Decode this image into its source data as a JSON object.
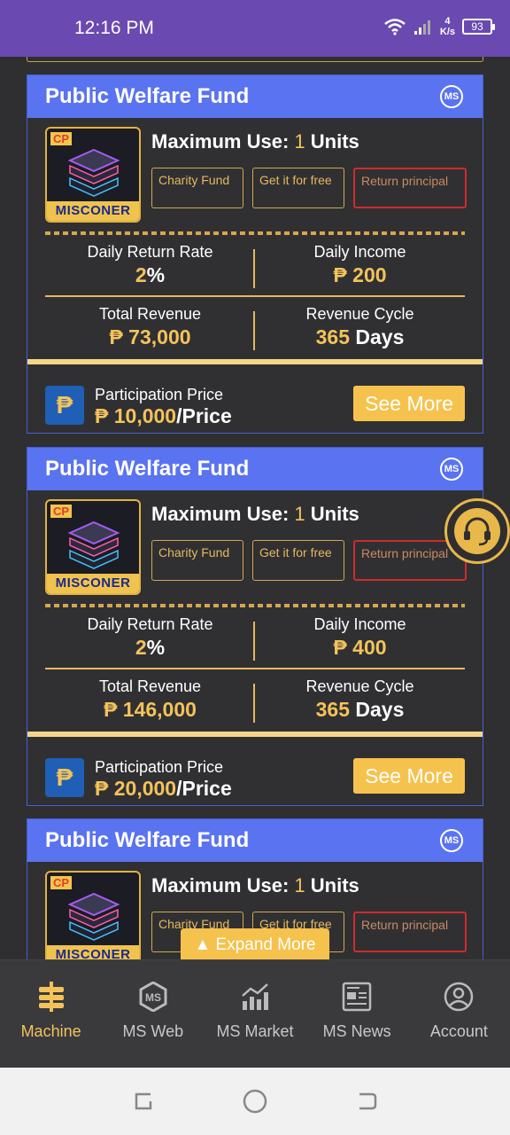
{
  "status_bar": {
    "time": "12:16 PM",
    "speed_value": "4",
    "speed_unit": "K/s",
    "battery": "93"
  },
  "cards": [
    {
      "title": "Public Welfare Fund",
      "badge": "MS",
      "cp_label": "CP",
      "brand": "MISCONER",
      "max_use_label": "Maximum Use:",
      "max_use_value": "1",
      "max_use_unit": "Units",
      "tags": [
        "Charity Fund",
        "Get it for free",
        "Return principal"
      ],
      "daily_return_label": "Daily Return Rate",
      "daily_return_value": "2",
      "daily_return_unit": "%",
      "daily_income_label": "Daily Income",
      "daily_income_value": "₱ 200",
      "total_revenue_label": "Total Revenue",
      "total_revenue_value": "₱ 73,000",
      "cycle_label": "Revenue Cycle",
      "cycle_value": "365",
      "cycle_unit": "Days",
      "price_label": "Participation Price",
      "price_value": "₱ 10,000",
      "price_unit": "/Price",
      "button": "See More"
    },
    {
      "title": "Public Welfare Fund",
      "badge": "MS",
      "cp_label": "CP",
      "brand": "MISCONER",
      "max_use_label": "Maximum Use:",
      "max_use_value": "1",
      "max_use_unit": "Units",
      "tags": [
        "Charity Fund",
        "Get it for free",
        "Return principal"
      ],
      "daily_return_label": "Daily Return Rate",
      "daily_return_value": "2",
      "daily_return_unit": "%",
      "daily_income_label": "Daily Income",
      "daily_income_value": "₱ 400",
      "total_revenue_label": "Total Revenue",
      "total_revenue_value": "₱ 146,000",
      "cycle_label": "Revenue Cycle",
      "cycle_value": "365",
      "cycle_unit": "Days",
      "price_label": "Participation Price",
      "price_value": "₱ 20,000",
      "price_unit": "/Price",
      "button": "See More"
    },
    {
      "title": "Public Welfare Fund",
      "badge": "MS",
      "cp_label": "CP",
      "brand": "MISCONER",
      "max_use_label": "Maximum Use:",
      "max_use_value": "1",
      "max_use_unit": "Units",
      "tags": [
        "Charity Fund",
        "Get it for free",
        "Return principal"
      ]
    }
  ],
  "price_icon": "₱",
  "expand_button": "▲ Expand More",
  "nav": [
    {
      "label": "Machine",
      "icon": "machine-icon",
      "active": true
    },
    {
      "label": "MS Web",
      "icon": "ms-web-icon"
    },
    {
      "label": "MS Market",
      "icon": "market-chart-icon"
    },
    {
      "label": "MS News",
      "icon": "news-icon"
    },
    {
      "label": "Account",
      "icon": "account-icon"
    }
  ],
  "colors": {
    "accent": "#f6c24e",
    "header_blue": "#5a73f0",
    "status_purple": "#6a4ab0",
    "background": "#2f2f31"
  }
}
